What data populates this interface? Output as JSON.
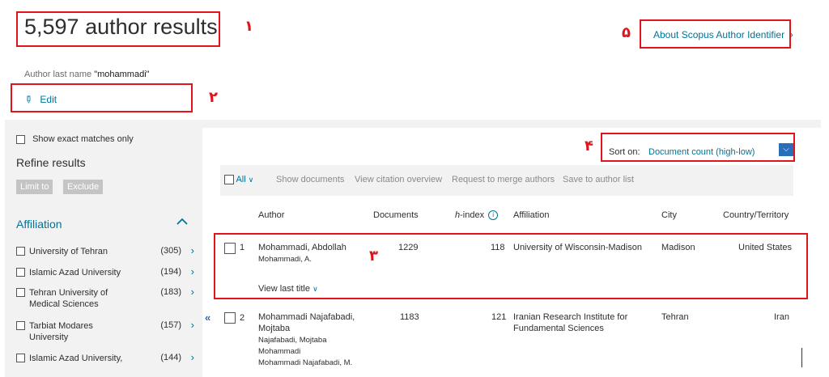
{
  "header": {
    "results_title": "5,597 author results",
    "about_link": "About Scopus Author Identifier",
    "query_label": "Author last name",
    "query_value": "\"mohammadi\"",
    "edit_label": "Edit"
  },
  "annotations": [
    "١",
    "٢",
    "٣",
    "۴",
    "۵"
  ],
  "sidebar": {
    "exact_matches_label": "Show exact matches only",
    "refine_title": "Refine results",
    "limit_to": "Limit to",
    "exclude": "Exclude",
    "affiliation_title": "Affiliation",
    "affiliations": [
      {
        "name": "University of Tehran",
        "count": "(305)"
      },
      {
        "name": "Islamic Azad University",
        "count": "(194)"
      },
      {
        "name": "Tehran University of Medical Sciences",
        "count": "(183)"
      },
      {
        "name": "Tarbiat Modares University",
        "count": "(157)"
      },
      {
        "name": "Islamic Azad University,",
        "count": "(144)"
      }
    ]
  },
  "sort": {
    "label": "Sort on:",
    "value": "Document count (high-low)"
  },
  "toolbar": {
    "all": "All",
    "show_documents": "Show documents",
    "view_citation": "View citation overview",
    "merge": "Request to merge authors",
    "save": "Save to author list"
  },
  "table": {
    "headers": {
      "author": "Author",
      "documents": "Documents",
      "hindex_h": "h",
      "hindex_rest": "-index",
      "affiliation": "Affiliation",
      "city": "City",
      "country": "Country/Territory"
    },
    "rows": [
      {
        "num": "1",
        "name": "Mohammadi, Abdollah",
        "variants": [
          "Mohammadi, A."
        ],
        "documents": "1229",
        "hindex": "118",
        "affiliation": "University of Wisconsin-Madison",
        "city": "Madison",
        "country": "United States",
        "view_last": "View last title"
      },
      {
        "num": "2",
        "name_line1": "Mohammadi Najafabadi,",
        "name_line2": "Mojtaba",
        "variants": [
          "Najafabadi, Mojtaba",
          "Mohammadi",
          "Mohammadi Najafabadi, M."
        ],
        "documents": "1183",
        "hindex": "121",
        "affiliation_line1": "Iranian Research Institute for",
        "affiliation_line2": "Fundamental Sciences",
        "city": "Tehran",
        "country": "Iran"
      }
    ]
  },
  "colors": {
    "accent": "#007398",
    "annotation": "#e0141b",
    "panel": "#f2f2f2"
  }
}
